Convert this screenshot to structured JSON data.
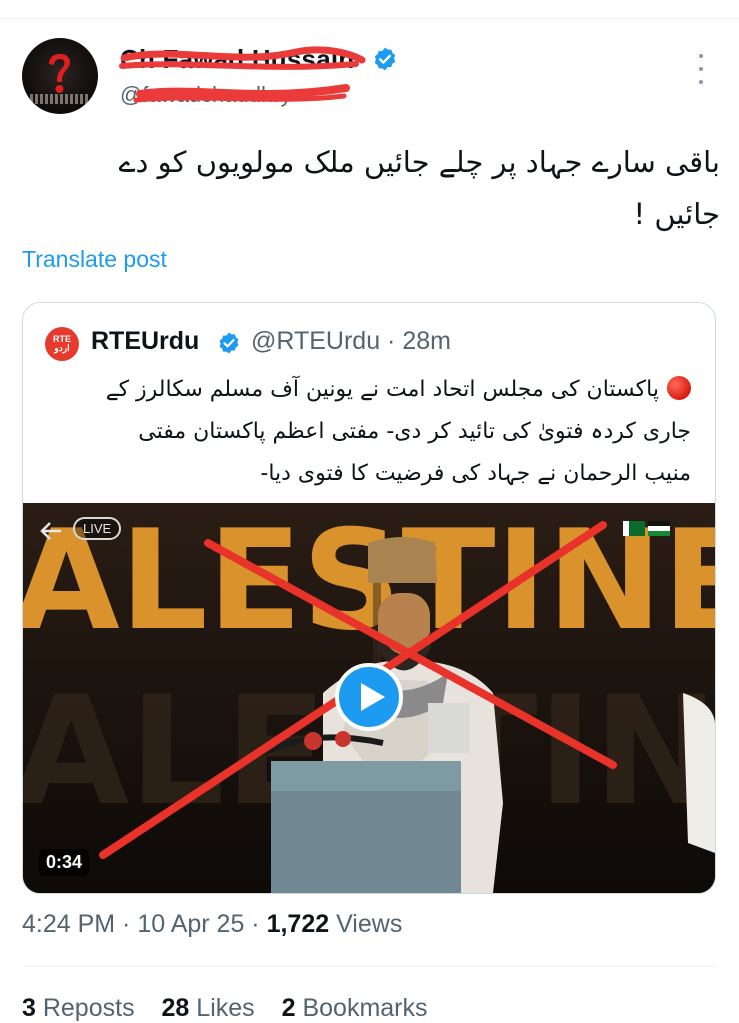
{
  "tweet": {
    "author_name": "Ch Fawad Hussain",
    "author_handle": "@fawadchaudhry",
    "more_icon": "more-dots-icon",
    "text_line1": "باقی سارے جہاد پر چلے جائیں ملک مولویوں کو دے",
    "text_line2": "جائیں !",
    "translate_label": "Translate post",
    "timestamp": "4:24 PM · 10 Apr 25 · ",
    "views_count": "1,722",
    "views_label": " Views",
    "reposts_count": "3",
    "reposts_label": " Reposts",
    "likes_count": "28",
    "likes_label": " Likes",
    "bookmarks_count": "2",
    "bookmarks_label": " Bookmarks"
  },
  "quoted": {
    "name": "RTEUrdu",
    "handle_time": "@RTEUrdu · 28m",
    "logo_text": "RTE اردو",
    "text_line1": "پاکستان کی مجلس اتحاد امت نے یونین آف مسلم سکالرز کے",
    "text_line2": "جاری کردہ فتویٰ کی تائید کر دی- مفتی اعظم پاکستان مفتی",
    "text_line3": "منیب الرحمان نے جہاد کی فرضیت کا فتوی دیا-",
    "video": {
      "live_label": "LIVE",
      "duration": "0:34",
      "background_text": "ALESTINE"
    }
  },
  "colors": {
    "accent": "#1d9bf0",
    "text": "#0f1419",
    "muted": "#536471",
    "annotation_red": "#e8322a"
  }
}
